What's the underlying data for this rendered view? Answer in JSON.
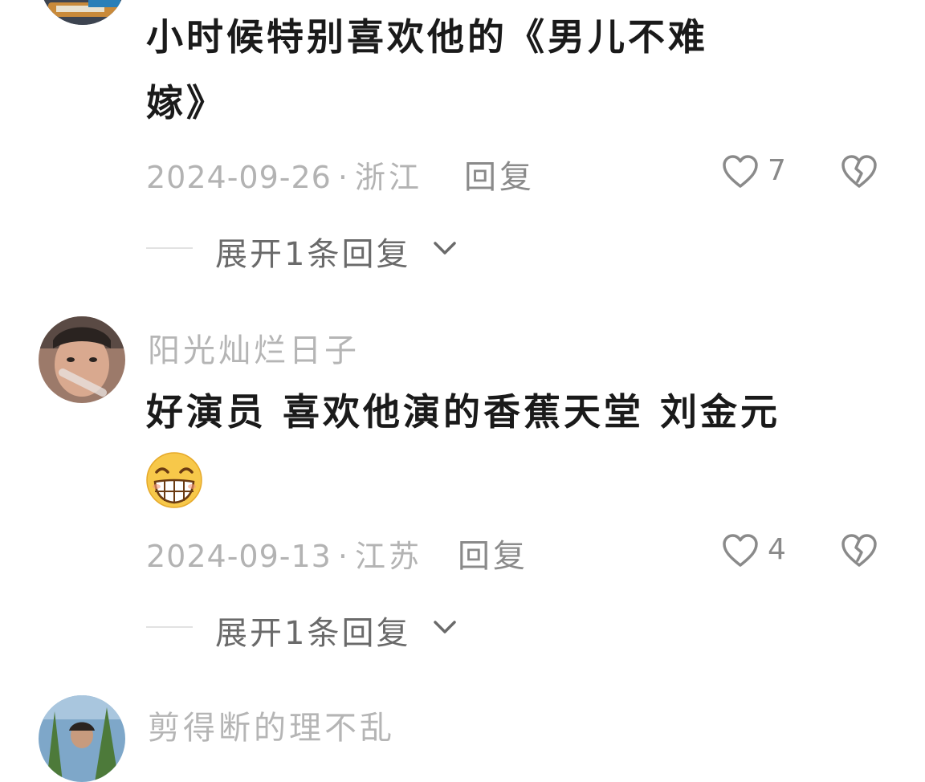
{
  "comments": [
    {
      "text_line1": "小时候特别喜欢他的《男儿不难",
      "text_line2": "嫁》",
      "date": "2024-09-26",
      "separator": "·",
      "location": "浙江",
      "reply_label": "回复",
      "likes": "7",
      "expand_label": "展开1条回复"
    },
    {
      "username": "阳光灿烂日子",
      "text_line1": "好演员 喜欢他演的香蕉天堂 刘金元",
      "emoji": "grinning-emoji",
      "date": "2024-09-13",
      "separator": "·",
      "location": "江苏",
      "reply_label": "回复",
      "likes": "4",
      "expand_label": "展开1条回复"
    },
    {
      "username": "剪得断的理不乱"
    }
  ],
  "colors": {
    "text": "#1a1a1a",
    "meta": "#b3b3b3",
    "icon": "#8a8a8a",
    "username": "#b5b5b5"
  },
  "icons": {
    "like": "heart-outline-icon",
    "dislike": "broken-heart-icon",
    "expand": "chevron-down-icon"
  }
}
